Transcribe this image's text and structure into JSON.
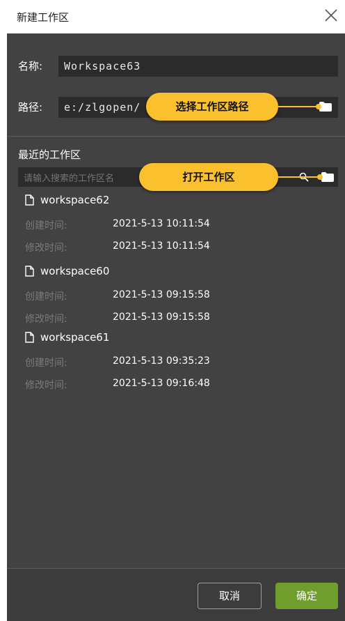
{
  "window": {
    "title": "新建工作区"
  },
  "form": {
    "name_label": "名称:",
    "name_value": "Workspace63",
    "path_label": "路径:",
    "path_value": "e:/zlgopen/"
  },
  "recent": {
    "heading": "最近的工作区",
    "search_placeholder": "请输入搜索的工作区名",
    "created_label": "创建时间:",
    "modified_label": "修改时间:",
    "items": [
      {
        "name": "workspace62",
        "created": "2021-5-13 10:11:54",
        "modified": "2021-5-13 10:11:54"
      },
      {
        "name": "workspace60",
        "created": "2021-5-13 09:15:58",
        "modified": "2021-5-13 09:15:58"
      },
      {
        "name": "workspace61",
        "created": "2021-5-13 09:35:23",
        "modified": "2021-5-13 09:16:48"
      }
    ]
  },
  "callouts": {
    "choose_path": "选择工作区路径",
    "open_workspace": "打开工作区"
  },
  "buttons": {
    "cancel": "取消",
    "ok": "确定"
  },
  "colors": {
    "dialog_bg": "#424242",
    "field_bg": "#2b2b2b",
    "callout": "#fbc02d",
    "ok_button": "#6f9e2d"
  },
  "icons": [
    "close-icon",
    "folder-icon",
    "search-icon",
    "file-icon"
  ]
}
